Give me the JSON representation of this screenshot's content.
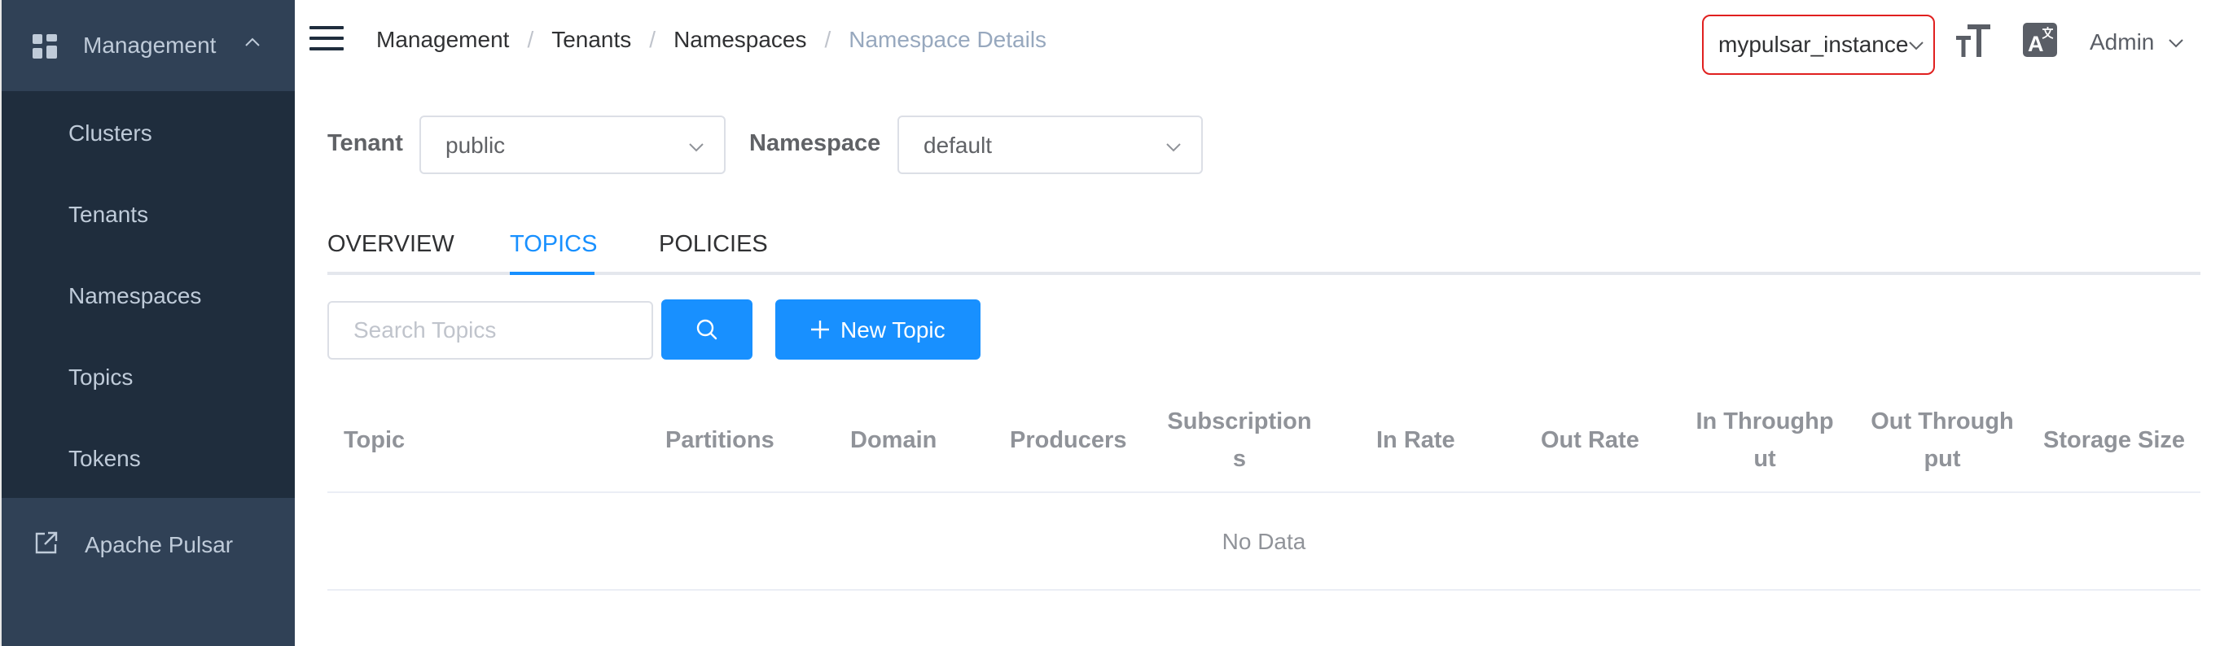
{
  "sidebar": {
    "group": {
      "label": "Management",
      "icon": "grid-icon",
      "expanded": true,
      "items": [
        {
          "label": "Clusters"
        },
        {
          "label": "Tenants"
        },
        {
          "label": "Namespaces"
        },
        {
          "label": "Topics"
        },
        {
          "label": "Tokens"
        }
      ]
    },
    "external": {
      "label": "Apache Pulsar",
      "icon": "external-link-icon"
    }
  },
  "header": {
    "breadcrumb": [
      "Management",
      "Tenants",
      "Namespaces",
      "Namespace Details"
    ],
    "breadcrumb_separator": "/",
    "instance": "mypulsar_instance",
    "user": "Admin"
  },
  "filters": {
    "tenant_label": "Tenant",
    "tenant_value": "public",
    "namespace_label": "Namespace",
    "namespace_value": "default"
  },
  "tabs": [
    {
      "label": "OVERVIEW",
      "active": false
    },
    {
      "label": "TOPICS",
      "active": true
    },
    {
      "label": "POLICIES",
      "active": false
    }
  ],
  "toolbar": {
    "search_placeholder": "Search Topics",
    "new_topic_label": "New Topic"
  },
  "table": {
    "columns": [
      {
        "line1": "Topic",
        "line2": ""
      },
      {
        "line1": "Partitions",
        "line2": ""
      },
      {
        "line1": "Domain",
        "line2": ""
      },
      {
        "line1": "Producers",
        "line2": ""
      },
      {
        "line1": "Subscription",
        "line2": "s"
      },
      {
        "line1": "In Rate",
        "line2": ""
      },
      {
        "line1": "Out Rate",
        "line2": ""
      },
      {
        "line1": "In Throughp",
        "line2": "ut"
      },
      {
        "line1": "Out Through",
        "line2": "put"
      },
      {
        "line1": "Storage Size",
        "line2": ""
      }
    ],
    "empty_text": "No Data"
  },
  "colors": {
    "sidebar_bg": "#304156",
    "submenu_bg": "#1f2d3d",
    "primary": "#1890ff",
    "highlight_border": "#e0201f",
    "breadcrumb_current": "#97a8be"
  }
}
